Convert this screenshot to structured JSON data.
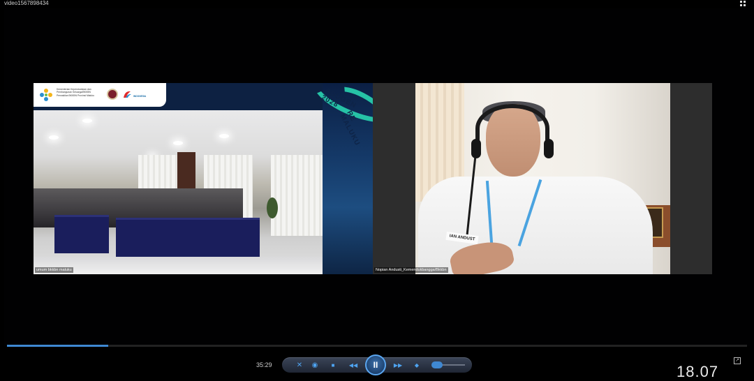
{
  "window": {
    "title": "video1567898434"
  },
  "participants": [
    {
      "name_label": "umum bkkbn maluku",
      "brand": {
        "line1": "Kementerian Kependudukan dan",
        "line2": "Pembangunan Keluarga/BKKBN",
        "line3": "Perwakilan BKKBN Provinsi Maluku",
        "logo_small_text": "INDONESIA"
      },
      "banner": {
        "text1": "ADUGEN 2028",
        "text2": "RE MALUKU",
        "letter_g": "G"
      }
    },
    {
      "name_label": "Nopian Andusti_Kemendukbangga/Bkkbn",
      "shirt_name": "IAN ANDUST"
    }
  ],
  "player": {
    "time_elapsed": "35:29",
    "progress": 0.137,
    "volume": 0.5,
    "buttons": {
      "shuffle": "✕",
      "repeat": "◉",
      "stop": "■",
      "rewind": "◀◀",
      "pause": "II",
      "forward": "▶▶",
      "next": "◆"
    }
  },
  "system": {
    "clock": "18.07"
  },
  "colors": {
    "accent": "#3f88d2",
    "teal": "#26c2a6",
    "navy": "#0d2142"
  }
}
